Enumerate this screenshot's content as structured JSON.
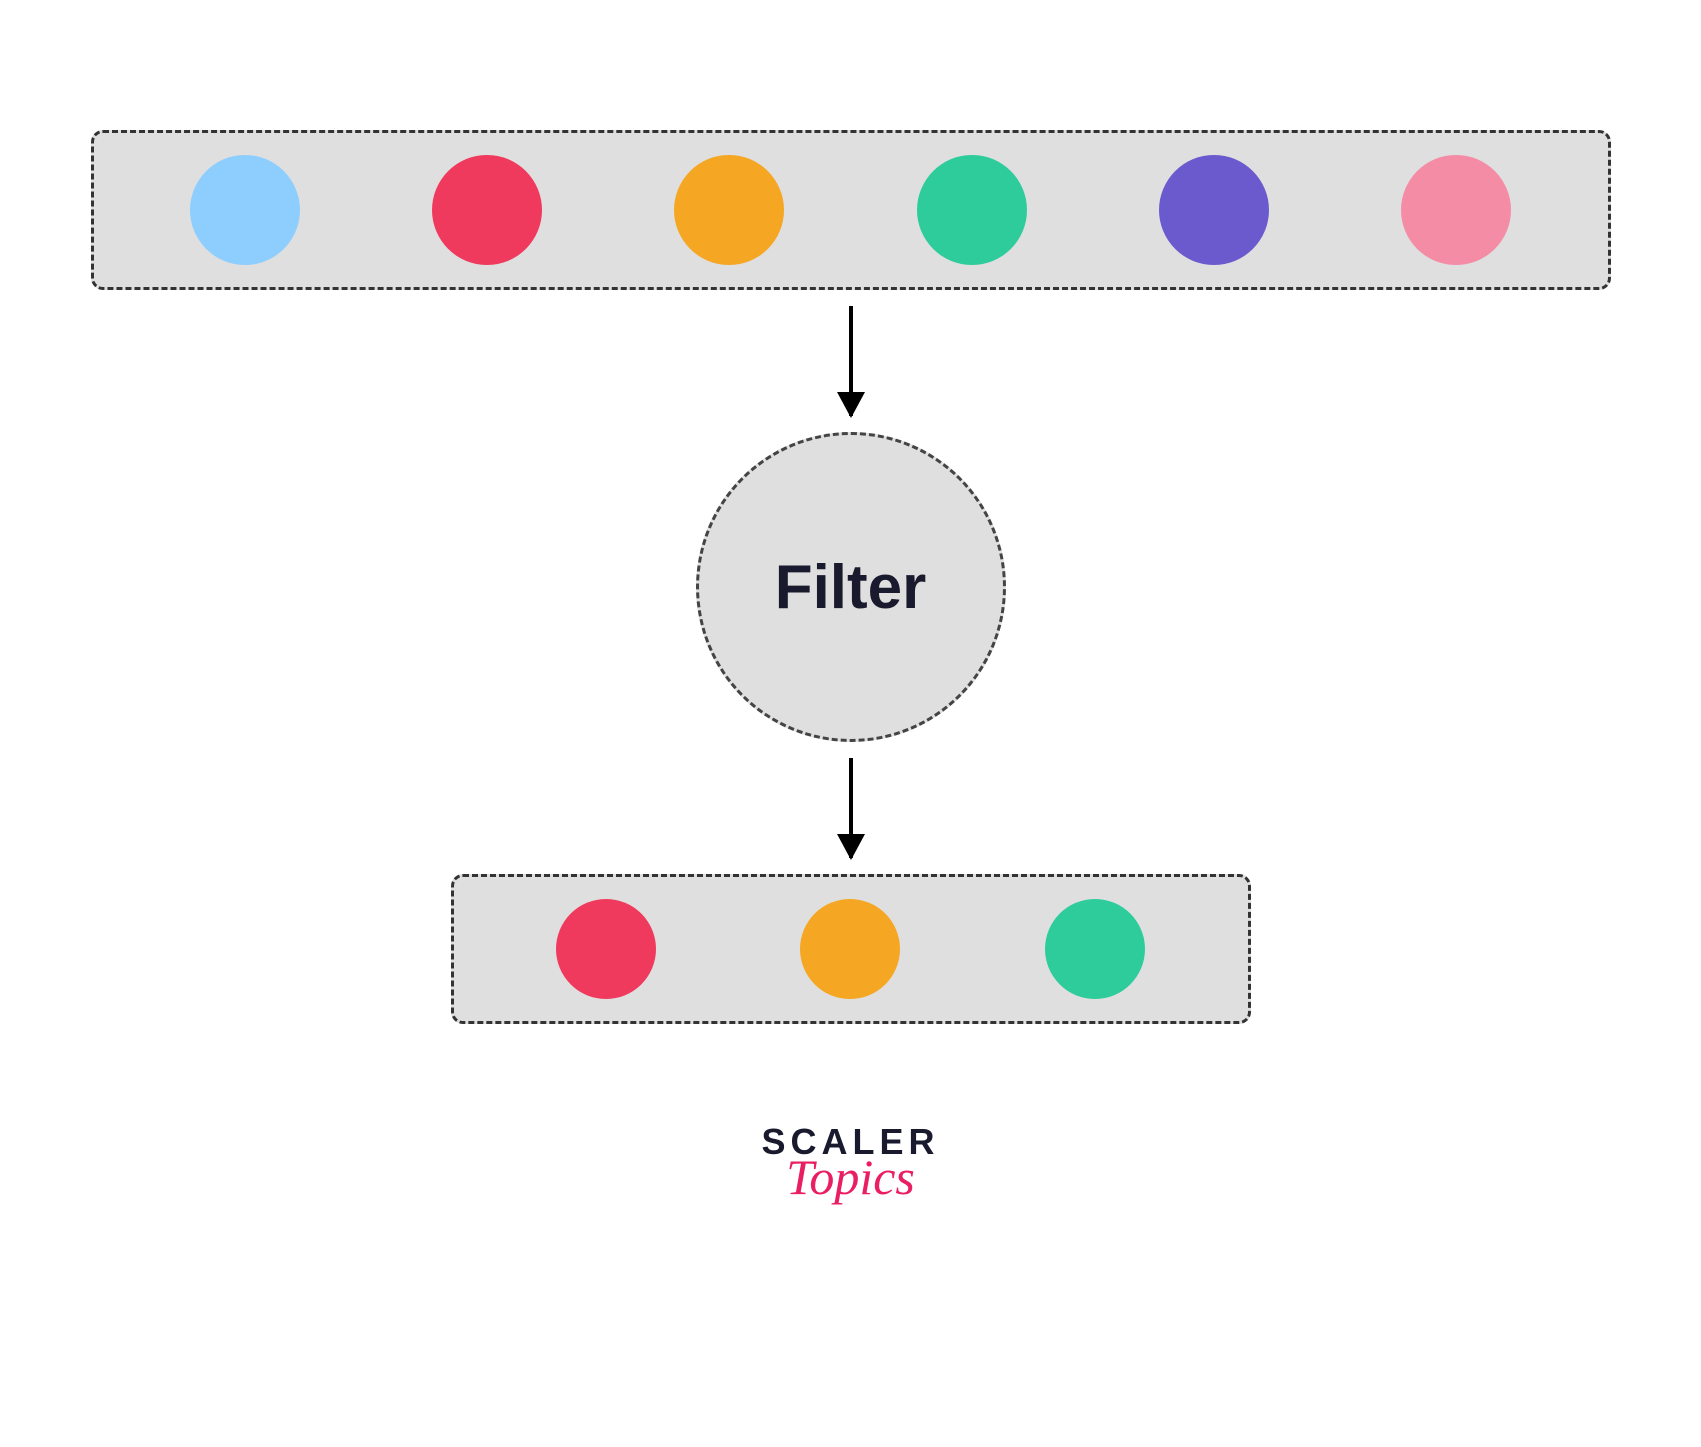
{
  "diagram": {
    "input_items": [
      {
        "name": "lightblue",
        "color": "#8dceff"
      },
      {
        "name": "red",
        "color": "#ef3a5d"
      },
      {
        "name": "orange",
        "color": "#f5a623"
      },
      {
        "name": "teal",
        "color": "#2ecc9b"
      },
      {
        "name": "purple",
        "color": "#6a5acd"
      },
      {
        "name": "pink",
        "color": "#f48ca6"
      }
    ],
    "filter_label": "Filter",
    "output_items": [
      {
        "name": "red",
        "color": "#ef3a5d"
      },
      {
        "name": "orange",
        "color": "#f5a623"
      },
      {
        "name": "teal",
        "color": "#2ecc9b"
      }
    ]
  },
  "brand": {
    "line1": "SCALER",
    "line2": "Topics"
  }
}
